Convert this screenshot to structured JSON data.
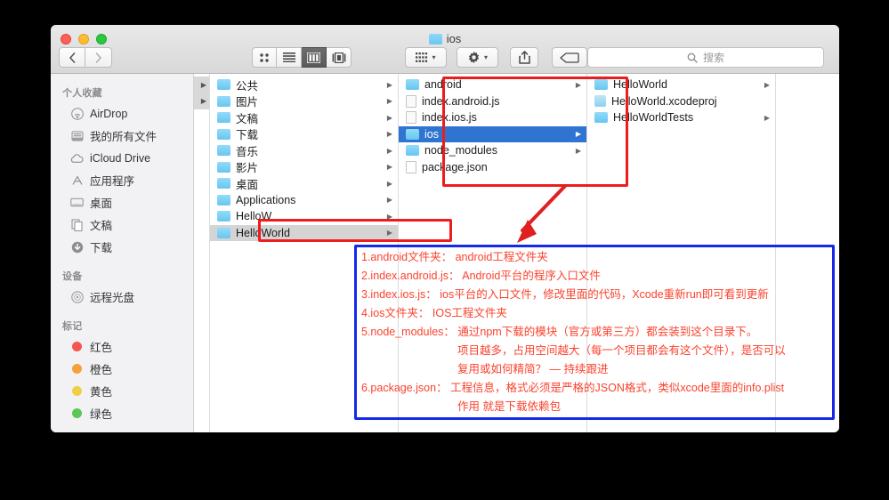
{
  "window": {
    "title": "ios",
    "traffic_lights": [
      "close",
      "minimize",
      "zoom"
    ]
  },
  "toolbar": {
    "back_label": "‹",
    "forward_label": "›",
    "view_icon_grid": "icon-view-icon",
    "view_list": "list-view-icon",
    "view_column": "column-view-icon",
    "view_gallery": "gallery-view-icon",
    "arrange_label": "",
    "action_label": "",
    "share_label": "",
    "tag_label": "",
    "caret": "▾"
  },
  "search": {
    "placeholder": "搜索",
    "value": ""
  },
  "sidebar": {
    "sections": [
      {
        "header": "个人收藏",
        "items": [
          {
            "label": "AirDrop",
            "icon": "airdrop-icon"
          },
          {
            "label": "我的所有文件",
            "icon": "all-my-files-icon"
          },
          {
            "label": "iCloud Drive",
            "icon": "icloud-icon"
          },
          {
            "label": "应用程序",
            "icon": "applications-icon"
          },
          {
            "label": "桌面",
            "icon": "desktop-icon"
          },
          {
            "label": "文稿",
            "icon": "documents-icon"
          },
          {
            "label": "下载",
            "icon": "downloads-icon"
          }
        ]
      },
      {
        "header": "设备",
        "items": [
          {
            "label": "远程光盘",
            "icon": "remote-disc-icon"
          }
        ]
      },
      {
        "header": "标记",
        "items": [
          {
            "label": "红色",
            "icon": "tag-dot-icon",
            "color": "#f5554f"
          },
          {
            "label": "橙色",
            "icon": "tag-dot-icon",
            "color": "#f5a03c"
          },
          {
            "label": "黄色",
            "icon": "tag-dot-icon",
            "color": "#f2ce48"
          },
          {
            "label": "绿色",
            "icon": "tag-dot-icon",
            "color": "#5fc45a"
          }
        ]
      }
    ]
  },
  "columns": [
    {
      "name": "column-home",
      "items": [
        {
          "label": "公共",
          "type": "folder",
          "has_arrow": true
        },
        {
          "label": "图片",
          "type": "folder",
          "has_arrow": true
        },
        {
          "label": "文稿",
          "type": "folder",
          "has_arrow": true
        },
        {
          "label": "下载",
          "type": "folder",
          "has_arrow": true
        },
        {
          "label": "音乐",
          "type": "folder",
          "has_arrow": true
        },
        {
          "label": "影片",
          "type": "folder",
          "has_arrow": true
        },
        {
          "label": "桌面",
          "type": "folder",
          "has_arrow": true
        },
        {
          "label": "Applications",
          "type": "folder",
          "has_arrow": true
        },
        {
          "label": "HelloW",
          "type": "folder",
          "has_arrow": true
        },
        {
          "label": "HelloWorld",
          "type": "folder",
          "has_arrow": true,
          "selected": "gray"
        }
      ]
    },
    {
      "name": "column-helloworld",
      "items": [
        {
          "label": "android",
          "type": "folder",
          "has_arrow": true
        },
        {
          "label": "index.android.js",
          "type": "file",
          "has_arrow": false
        },
        {
          "label": "index.ios.js",
          "type": "file",
          "has_arrow": false
        },
        {
          "label": "ios",
          "type": "folder",
          "has_arrow": true,
          "selected": "blue"
        },
        {
          "label": "node_modules",
          "type": "folder",
          "has_arrow": true
        },
        {
          "label": "package.json",
          "type": "file",
          "has_arrow": false
        }
      ]
    },
    {
      "name": "column-ios",
      "items": [
        {
          "label": "HelloWorld",
          "type": "folder",
          "has_arrow": true
        },
        {
          "label": "HelloWorld.xcodeproj",
          "type": "xcode",
          "has_arrow": false
        },
        {
          "label": "HelloWorldTests",
          "type": "folder",
          "has_arrow": true
        }
      ]
    }
  ],
  "annotation": {
    "red_box_color": "#ee1c1c",
    "blue_box_color": "#1429e8",
    "text_color": "#f9432e",
    "lines": [
      "1.android文件夹： android工程文件夹",
      "2.index.android.js： Android平台的程序入口文件",
      "3.index.ios.js： ios平台的入口文件，修改里面的代码，Xcode重新run即可看到更新",
      "4.ios文件夹： IOS工程文件夹",
      "5.node_modules： 通过npm下载的模块（官方或第三方）都会装到这个目录下。",
      "项目越多，占用空间越大（每一个项目都会有这个文件），是否可以",
      "复用或如何精简？ — 持续跟进",
      "6.package.json： 工程信息，格式必须是严格的JSON格式，类似xcode里面的info.plist",
      "作用 就是下载依赖包"
    ]
  }
}
